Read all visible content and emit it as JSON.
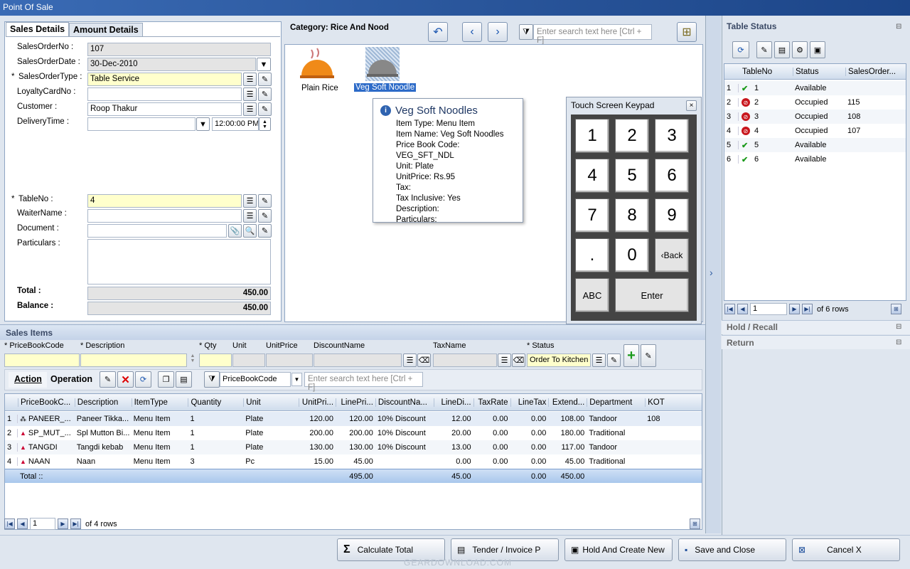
{
  "window": {
    "title": "Point Of Sale"
  },
  "tabs": {
    "sales_details": "Sales Details",
    "amount_details": "Amount Details"
  },
  "form": {
    "sales_order_no_label": "SalesOrderNo :",
    "sales_order_no": "107",
    "sales_order_date_label": "SalesOrderDate :",
    "sales_order_date": "30-Dec-2010",
    "sales_order_type_label": "SalesOrderType :",
    "sales_order_type": "Table Service",
    "loyalty_label": "LoyaltyCardNo :",
    "loyalty": "",
    "customer_label": "Customer :",
    "customer": "Roop Thakur",
    "delivery_label": "DeliveryTime :",
    "delivery_time": "12:00:00 PM",
    "table_no_label": "TableNo :",
    "table_no": "4",
    "waiter_label": "WaiterName :",
    "waiter": "",
    "document_label": "Document :",
    "particulars_label": "Particulars :",
    "total_label": "Total :",
    "total": "450.00",
    "balance_label": "Balance :",
    "balance": "450.00",
    "required_mark": "*"
  },
  "category": {
    "title": "Category: Rice And Nood",
    "search_placeholder": "Enter search text here [Ctrl + F]",
    "items": [
      {
        "name": "Plain Rice"
      },
      {
        "name": "Veg Soft Noodle"
      }
    ]
  },
  "tooltip": {
    "title": "Veg Soft Noodles",
    "lines": [
      "Item Type: Menu Item",
      "Item Name: Veg Soft Noodles",
      "Price Book Code: VEG_SFT_NDL",
      "Unit: Plate",
      "UnitPrice: Rs.95",
      "Tax:",
      "Tax Inclusive: Yes",
      "Description:",
      "Particulars:"
    ]
  },
  "keypad": {
    "title": "Touch Screen Keypad",
    "close": "×",
    "keys": [
      "1",
      "2",
      "3",
      "4",
      "5",
      "6",
      "7",
      "8",
      "9",
      ".",
      "0",
      "‹Back"
    ],
    "abc": "ABC",
    "enter": "Enter"
  },
  "table_status": {
    "title": "Table Status",
    "columns": [
      "TableNo",
      "Status",
      "SalesOrder..."
    ],
    "rows": [
      {
        "n": "1",
        "table": "1",
        "status": "Available",
        "order": "",
        "ok": true
      },
      {
        "n": "2",
        "table": "2",
        "status": "Occupied",
        "order": "115",
        "ok": false
      },
      {
        "n": "3",
        "table": "3",
        "status": "Occupied",
        "order": "108",
        "ok": false
      },
      {
        "n": "4",
        "table": "4",
        "status": "Occupied",
        "order": "107",
        "ok": false
      },
      {
        "n": "5",
        "table": "5",
        "status": "Available",
        "order": "",
        "ok": true
      },
      {
        "n": "6",
        "table": "6",
        "status": "Available",
        "order": "",
        "ok": true
      }
    ],
    "page": "1",
    "of_rows": "of 6 rows",
    "hold_recall": "Hold / Recall",
    "return": "Return"
  },
  "sales_items": {
    "title": "Sales Items",
    "entry_labels": {
      "pbc": "PriceBookCode",
      "desc": "Description",
      "qty": "Qty",
      "unit": "Unit",
      "unit_price": "UnitPrice",
      "discount": "DiscountName",
      "tax": "TaxName",
      "status": "Status"
    },
    "status_value": "Order To Kitchen",
    "action": "Action",
    "operation": "Operation",
    "filter_value": "PriceBookCode",
    "search_placeholder": "Enter search text here [Ctrl + F]",
    "columns": [
      "PriceBookC...",
      "Description",
      "ItemType",
      "Quantity",
      "Unit",
      "UnitPri...",
      "LinePri...",
      "DiscountNa...",
      "LineDi...",
      "TaxRate",
      "LineTax",
      "Extend...",
      "Department",
      "KOT"
    ],
    "rows": [
      [
        "PANEER_...",
        "Paneer Tikka...",
        "Menu Item",
        "1",
        "Plate",
        "120.00",
        "120.00",
        "10% Discount",
        "12.00",
        "0.00",
        "0.00",
        "108.00",
        "Tandoor",
        "108"
      ],
      [
        "SP_MUT_...",
        "Spl Mutton Bi...",
        "Menu Item",
        "1",
        "Plate",
        "200.00",
        "200.00",
        "10% Discount",
        "20.00",
        "0.00",
        "0.00",
        "180.00",
        "Traditional",
        ""
      ],
      [
        "TANGDI",
        "Tangdi kebab",
        "Menu Item",
        "1",
        "Plate",
        "130.00",
        "130.00",
        "10% Discount",
        "13.00",
        "0.00",
        "0.00",
        "117.00",
        "Tandoor",
        ""
      ],
      [
        "NAAN",
        "Naan",
        "Menu Item",
        "3",
        "Pc",
        "15.00",
        "45.00",
        "",
        "0.00",
        "0.00",
        "0.00",
        "45.00",
        "Traditional",
        ""
      ]
    ],
    "total_label": "Total ::",
    "total_line_price": "495.00",
    "total_line_disc": "45.00",
    "total_line_tax": "0.00",
    "total_extended": "450.00",
    "page": "1",
    "of_rows": "of 4 rows"
  },
  "bottom_buttons": {
    "calc": "Calculate Total",
    "tender": "Tender / Invoice P",
    "hold": "Hold And Create New",
    "save": "Save and Close",
    "cancel": "Cancel X"
  },
  "watermark": "GEARDOWNLOAD.COM"
}
